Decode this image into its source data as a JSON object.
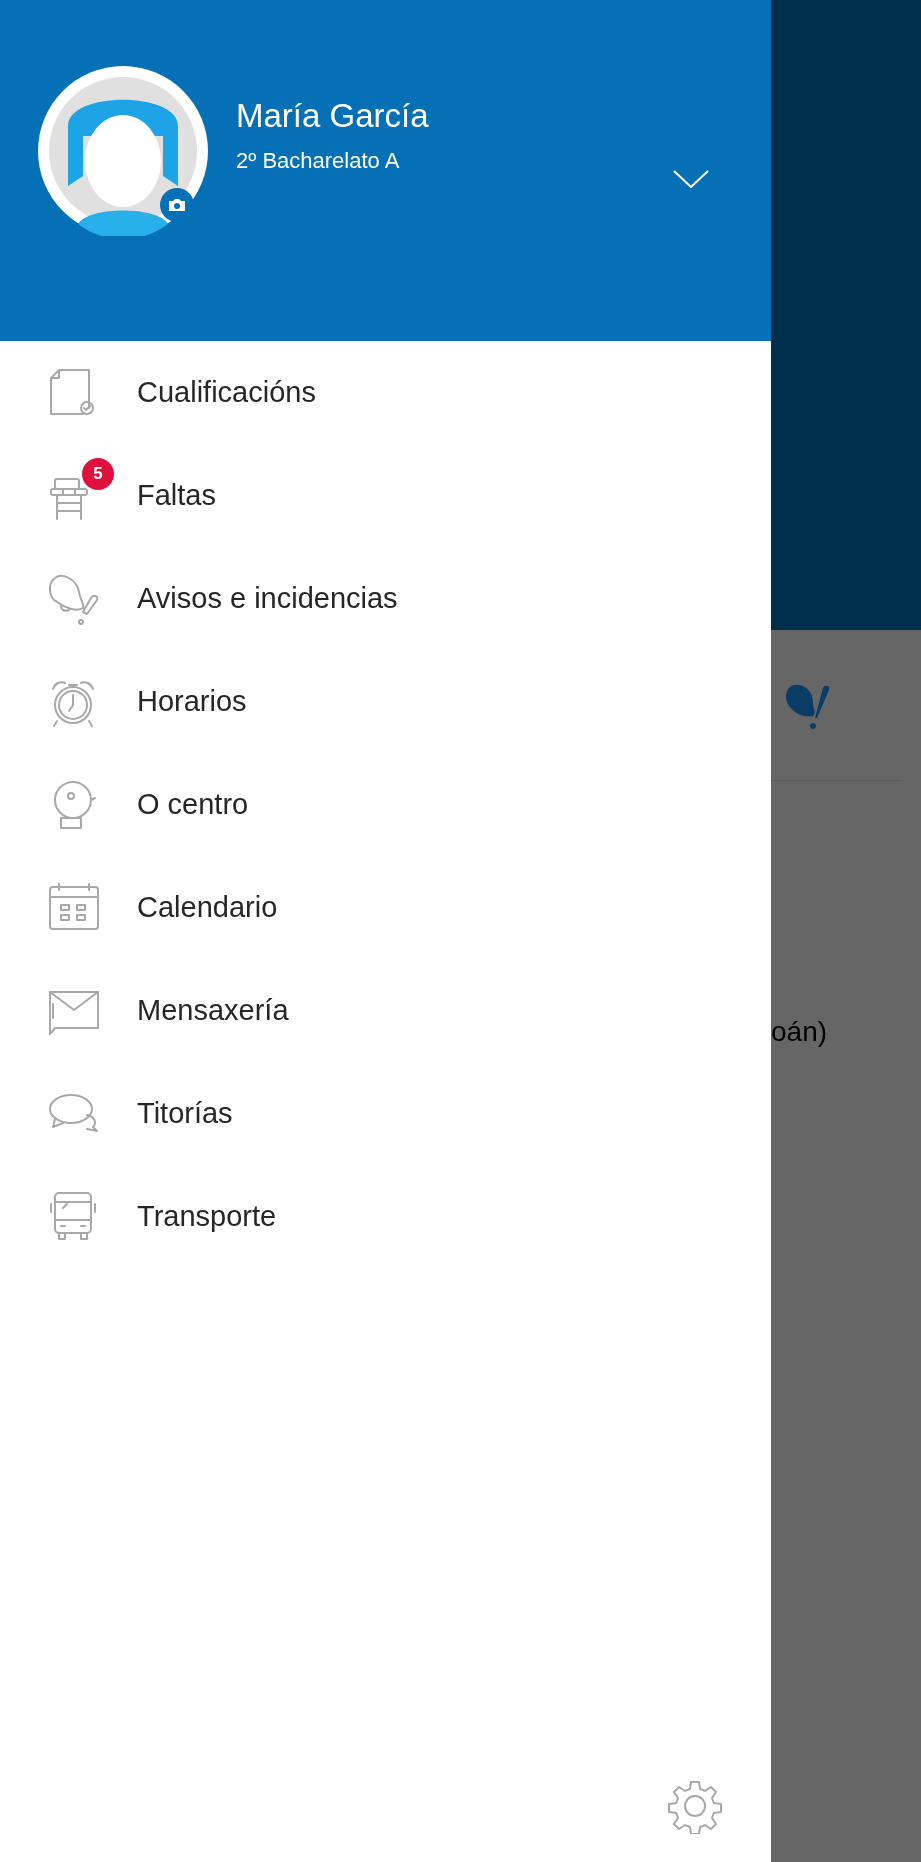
{
  "profile": {
    "name": "María García",
    "group": "2º Bacharelato A"
  },
  "menu": [
    {
      "label": "Cualificacións"
    },
    {
      "label": "Faltas",
      "badge": "5"
    },
    {
      "label": "Avisos e incidencias"
    },
    {
      "label": "Horarios"
    },
    {
      "label": "O centro"
    },
    {
      "label": "Calendario"
    },
    {
      "label": "Mensaxería"
    },
    {
      "label": "Titorías"
    },
    {
      "label": "Transporte"
    }
  ],
  "backdrop": {
    "text": "oán)"
  }
}
